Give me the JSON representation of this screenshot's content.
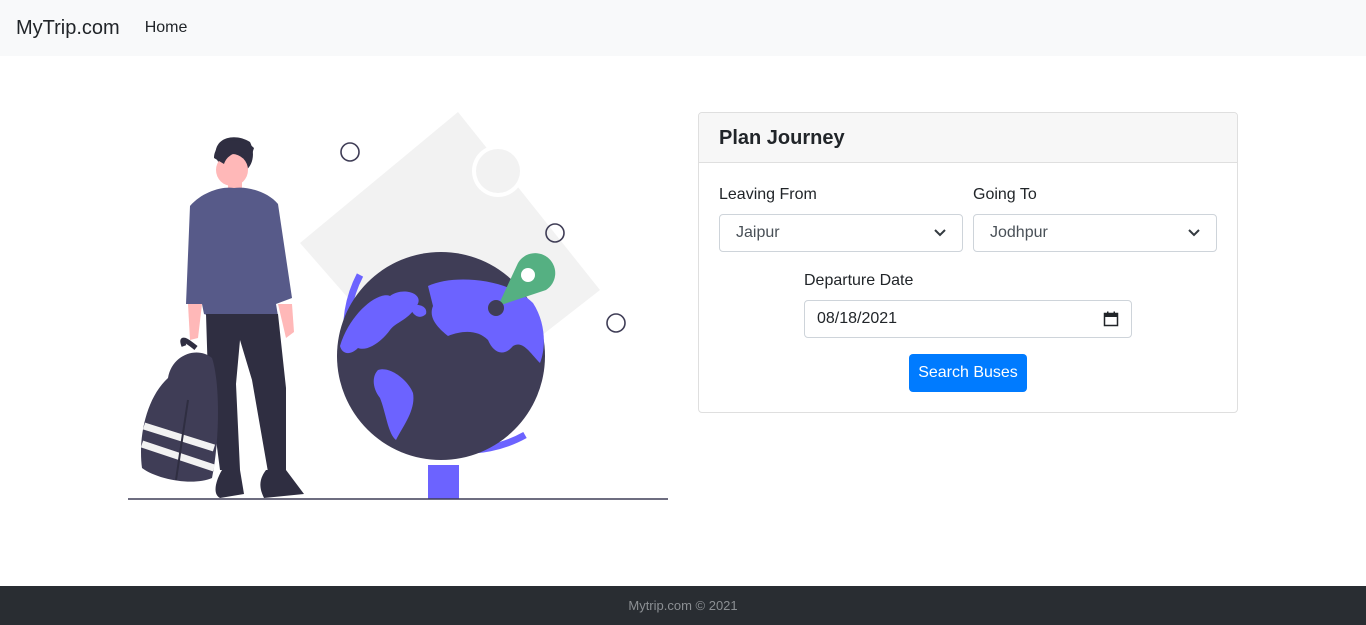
{
  "navbar": {
    "brand": "MyTrip.com",
    "home": "Home"
  },
  "card": {
    "title": "Plan Journey",
    "leaving_label": "Leaving From",
    "leaving_value": "Jaipur",
    "going_label": "Going To",
    "going_value": "Jodhpur",
    "date_label": "Departure Date",
    "date_value": "08/18/2021",
    "search_button": "Search Buses"
  },
  "footer": {
    "text": "Mytrip.com © 2021"
  },
  "colors": {
    "primary": "#007bff",
    "accent": "#6c63ff",
    "globe": "#3f3d56",
    "pin": "#55b082"
  },
  "icons": {
    "calendar": "calendar-icon",
    "chevron": "chevron-down-icon"
  }
}
